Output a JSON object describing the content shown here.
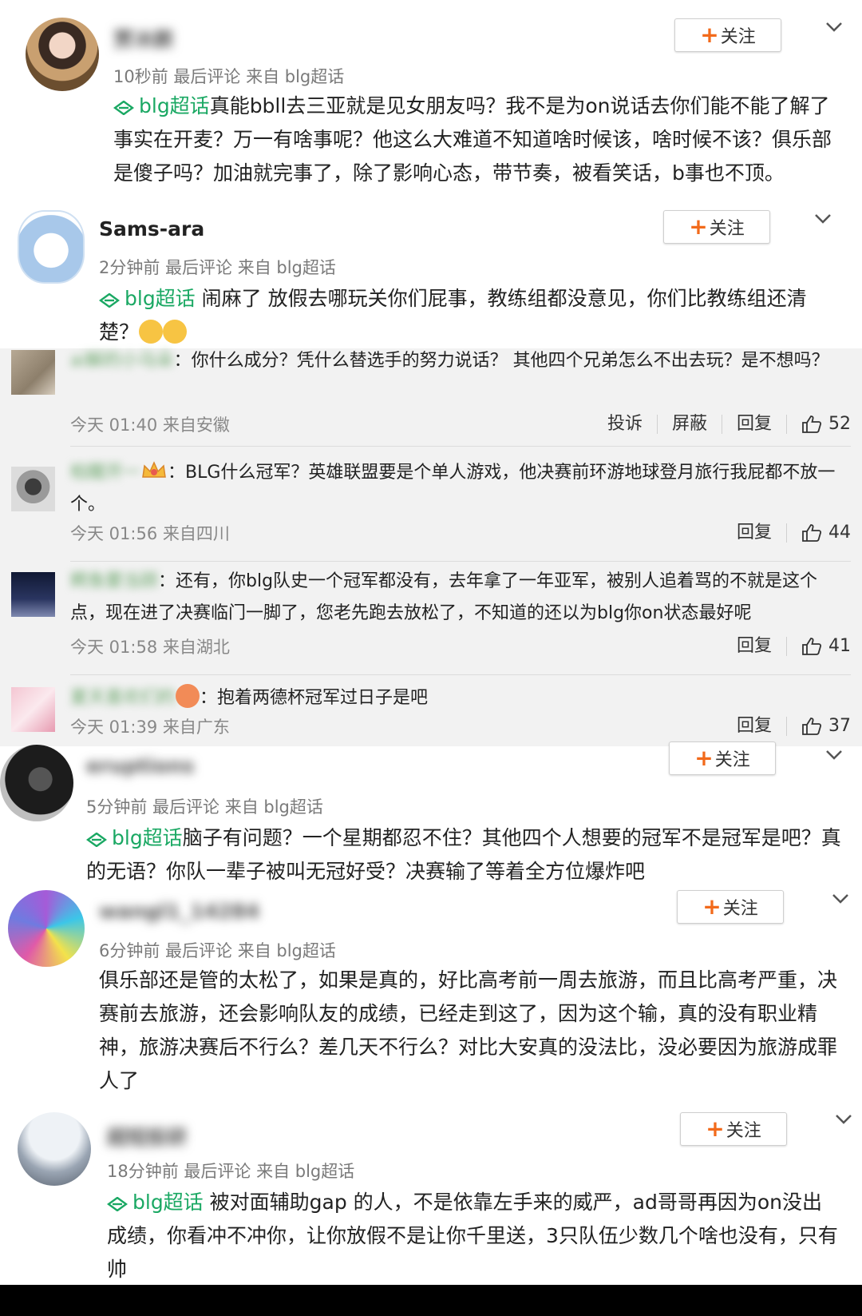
{
  "follow_label": "关注",
  "topic_label": "blg超话",
  "posts": [
    {
      "username": "贾冰颜",
      "meta": "10秒前  最后评论  来自 blg超话",
      "text": "真能bbll去三亚就是见女朋友吗？我不是为on说话去你们能不能了解了事实在开麦？万一有啥事呢？他这么大难道不知道啥时候该，啥时候不该？俱乐部是傻子吗？加油就完事了，除了影响心态，带节奏，被看笑话，b事也不顶。"
    },
    {
      "username": "Sams-ara",
      "meta": "2分钟前  最后评论  来自 blg超话",
      "text": "闹麻了 放假去哪玩关你们屁事，教练组都没意见，你们比教练组还清楚？"
    },
    {
      "username": "eruptions",
      "meta": "5分钟前  最后评论  来自 blg超话",
      "text": "脑子有问题？一个星期都忍不住？其他四个人想要的冠军不是冠军是吧？真的无语？你队一辈子被叫无冠好受？决赛输了等着全方位爆炸吧"
    },
    {
      "username": "wangl1_14284",
      "meta": "6分钟前  最后评论  来自 blg超话",
      "text": "俱乐部还是管的太松了，如果是真的，好比高考前一周去旅游，而且比高考严重，决赛前去旅游，还会影响队友的成绩，已经走到这了，因为这个输，真的没有职业精神，旅游决赛后不行么？差几天不行么？对比大安真的没法比，没必要因为旅游成罪人了"
    },
    {
      "username": "超短投研",
      "meta": "18分钟前  最后评论  来自 blg超话",
      "text": "被对面辅助gap 的人，不是依靠左手来的威严，ad哥哥再因为on没出成绩，你看冲不冲你，让你放假不是让你千里送，3只队伍少数几个啥也没有，只有帅"
    }
  ],
  "replies": [
    {
      "name": "ai解的小马朵",
      "text": "：你什么成分？凭什么替选手的努力说话？ 其他四个兄弟怎么不出去玩？是不想吗？",
      "time": "今天 01:40 来自安徽",
      "actions": [
        "投诉",
        "屏蔽",
        "回复"
      ],
      "likes": "52"
    },
    {
      "name": "柏醒开一",
      "text": "：BLG什么冠军？英雄联盟要是个单人游戏，他决赛前环游地球登月旅行我屁都不放一个。",
      "time": "今天 01:56 来自四川",
      "actions": [
        "回复"
      ],
      "likes": "44"
    },
    {
      "name": "鳄鱼要当顾",
      "text": "：还有，你blg队史一个冠军都没有，去年拿了一年亚军，被别人追着骂的不就是这个点，现在进了决赛临门一脚了，您老先跑去放松了，不知道的还以为blg你on状态最好呢",
      "time": "今天 01:58 来自湖北",
      "actions": [
        "回复"
      ],
      "likes": "41"
    },
    {
      "name": "夏天喜欢们的",
      "text": "：抱着两德杯冠军过日子是吧",
      "time": "今天 01:39 来自广东",
      "actions": [
        "回复"
      ],
      "likes": "37"
    }
  ]
}
